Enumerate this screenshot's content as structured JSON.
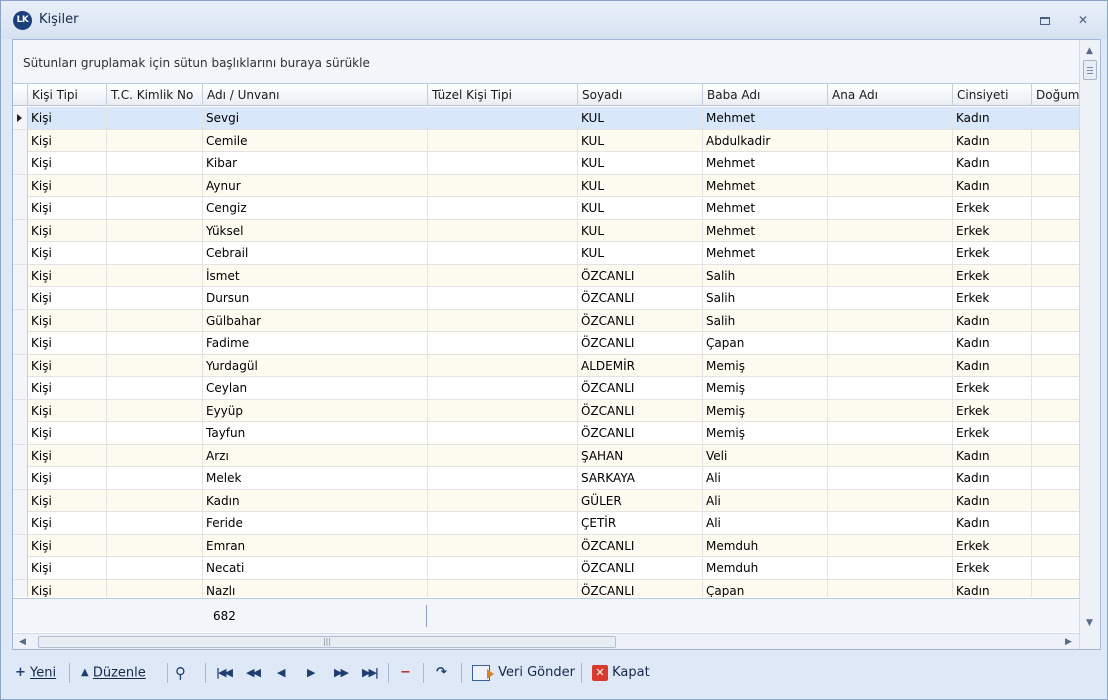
{
  "window": {
    "title": "Kişiler",
    "logo_text": "LK"
  },
  "grid": {
    "group_panel_text": "Sütunları gruplamak için sütun başlıklarını buraya sürükle",
    "columns": [
      "Kişi Tipi",
      "T.C. Kimlik No",
      "Adı / Unvanı",
      "Tüzel Kişi Tipi",
      "Soyadı",
      "Baba Adı",
      "Ana Adı",
      "Cinsiyeti",
      "Doğum"
    ],
    "rows": [
      [
        "Kişi",
        "",
        "Sevgi",
        "",
        "KUL",
        "Mehmet",
        "",
        "Kadın",
        ""
      ],
      [
        "Kişi",
        "",
        "Cemile",
        "",
        "KUL",
        "Abdulkadir",
        "",
        "Kadın",
        ""
      ],
      [
        "Kişi",
        "",
        "Kibar",
        "",
        "KUL",
        "Mehmet",
        "",
        "Kadın",
        ""
      ],
      [
        "Kişi",
        "",
        "Aynur",
        "",
        "KUL",
        "Mehmet",
        "",
        "Kadın",
        ""
      ],
      [
        "Kişi",
        "",
        "Cengiz",
        "",
        "KUL",
        "Mehmet",
        "",
        "Erkek",
        ""
      ],
      [
        "Kişi",
        "",
        "Yüksel",
        "",
        "KUL",
        "Mehmet",
        "",
        "Erkek",
        ""
      ],
      [
        "Kişi",
        "",
        "Cebrail",
        "",
        "KUL",
        "Mehmet",
        "",
        "Erkek",
        ""
      ],
      [
        "Kişi",
        "",
        "İsmet",
        "",
        "ÖZCANLI",
        "Salih",
        "",
        "Erkek",
        ""
      ],
      [
        "Kişi",
        "",
        "Dursun",
        "",
        "ÖZCANLI",
        "Salih",
        "",
        "Erkek",
        ""
      ],
      [
        "Kişi",
        "",
        "Gülbahar",
        "",
        "ÖZCANLI",
        "Salih",
        "",
        "Kadın",
        ""
      ],
      [
        "Kişi",
        "",
        "Fadime",
        "",
        "ÖZCANLI",
        "Çapan",
        "",
        "Kadın",
        ""
      ],
      [
        "Kişi",
        "",
        "Yurdagül",
        "",
        "ALDEMİR",
        "Memiş",
        "",
        "Kadın",
        ""
      ],
      [
        "Kişi",
        "",
        "Ceylan",
        "",
        "ÖZCANLI",
        "Memiş",
        "",
        "Erkek",
        ""
      ],
      [
        "Kişi",
        "",
        "Eyyüp",
        "",
        "ÖZCANLI",
        "Memiş",
        "",
        "Erkek",
        ""
      ],
      [
        "Kişi",
        "",
        "Tayfun",
        "",
        "ÖZCANLI",
        "Memiş",
        "",
        "Erkek",
        ""
      ],
      [
        "Kişi",
        "",
        "Arzı",
        "",
        "ŞAHAN",
        "Veli",
        "",
        "Kadın",
        ""
      ],
      [
        "Kişi",
        "",
        "Melek",
        "",
        "SARKAYA",
        "Ali",
        "",
        "Kadın",
        ""
      ],
      [
        "Kişi",
        "",
        "Kadın",
        "",
        "GÜLER",
        "Ali",
        "",
        "Kadın",
        ""
      ],
      [
        "Kişi",
        "",
        "Feride",
        "",
        "ÇETİR",
        "Ali",
        "",
        "Kadın",
        ""
      ],
      [
        "Kişi",
        "",
        "Emran",
        "",
        "ÖZCANLI",
        "Memduh",
        "",
        "Erkek",
        ""
      ],
      [
        "Kişi",
        "",
        "Necati",
        "",
        "ÖZCANLI",
        "Memduh",
        "",
        "Erkek",
        ""
      ],
      [
        "Kişi",
        "",
        "Nazlı",
        "",
        "ÖZCANLI",
        "Çapan",
        "",
        "Kadın",
        ""
      ]
    ],
    "selected_row": 0,
    "footer_count": "682"
  },
  "toolbar": {
    "new_label": "Yeni",
    "edit_label": "Düzenle",
    "send_label": "Veri Gönder",
    "close_label": "Kapat"
  },
  "colors": {
    "accent": "#1d3e6e",
    "selected_row": "#d9e7fb",
    "alt_row": "#fdfaf0",
    "close_red": "#d93a2b"
  }
}
